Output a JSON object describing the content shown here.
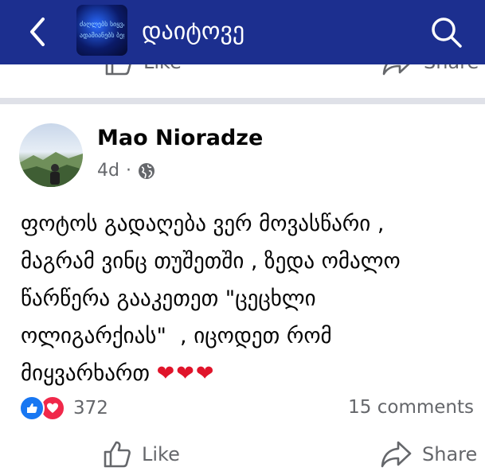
{
  "header": {
    "group_name": "დაიტოვე",
    "thumb_line1": "ძაღლებს სიყვარ",
    "thumb_line2": "ადამიანებს ბედნი",
    "back_icon": "chevron-left-icon",
    "search_icon": "search-icon"
  },
  "previous_post": {
    "like_label": "Like",
    "share_label": "Share"
  },
  "post": {
    "author": "Mao Nioradze",
    "time": "4d",
    "separator": "·",
    "privacy_icon": "globe-icon",
    "text": "ფოტოს გადაღება ვერ მოვასწარი ,\nმაგრამ ვინც თუშეთში , ზედა ომალო\nწარწერა გააკეთეთ \"ცეცხლი\nოლიგარქიას\"  , იცოდეთ რომ\nმიყვარხართ ",
    "emoji": "❤❤❤",
    "reaction_count": "372",
    "comments": "15 comments",
    "like_label": "Like",
    "share_label": "Share"
  },
  "colors": {
    "appbar": "#1c2f8f",
    "like": "#1877f2",
    "love": "#f0284a",
    "secondary_text": "#65676b"
  }
}
